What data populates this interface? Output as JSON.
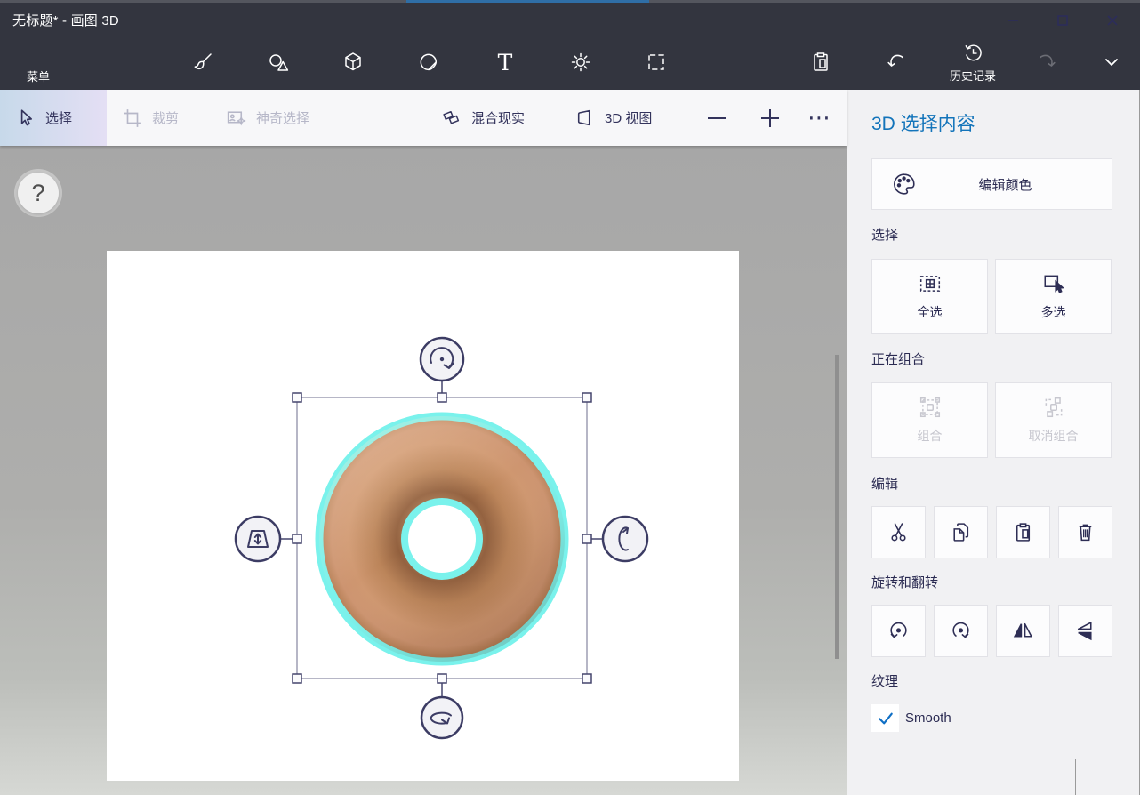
{
  "colors": {
    "accent_blue": "#1374ba",
    "header_bg": "#33353f",
    "selection_glow_cyan": "#7af2ec",
    "donut_brown": "#cf9770",
    "ribbon_selected_gradient": [
      "#c7d9ea",
      "#e4dff4"
    ]
  },
  "titlebar": {
    "title": "无标题* - 画图 3D"
  },
  "toolbar": {
    "menu_label": "菜单",
    "history_label": "历史记录",
    "icons": [
      "menu-folder",
      "brush",
      "shapes-2d",
      "shapes-3d",
      "stickers",
      "text",
      "effects",
      "canvas",
      "paste",
      "undo",
      "history-clock",
      "redo-disabled",
      "chevron-down"
    ]
  },
  "ribbon": {
    "select": "选择",
    "crop": "裁剪",
    "magic_select": "神奇选择",
    "mixed_reality": "混合现实",
    "view_3d": "3D 视图",
    "more": "⋯"
  },
  "workspace": {
    "help": "?",
    "object": "3d-torus-donut-selected",
    "rotation_handles": [
      "rotate-z-top",
      "depth-left",
      "rotate-y-right",
      "rotate-x-bottom"
    ]
  },
  "panel": {
    "title": "3D 选择内容",
    "edit_color": "编辑颜色",
    "select_section": {
      "label": "选择",
      "select_all": "全选",
      "multi_select": "多选"
    },
    "group_section": {
      "label": "正在组合",
      "group": "组合",
      "ungroup": "取消组合"
    },
    "edit_section": {
      "label": "编辑",
      "icons": [
        "cut",
        "copy",
        "paste",
        "delete"
      ]
    },
    "rotate_section": {
      "label": "旋转和翻转",
      "icons": [
        "rotate-left",
        "rotate-right",
        "flip-horizontal",
        "flip-vertical"
      ]
    },
    "texture_section": {
      "label": "纹理",
      "smooth_label": "Smooth",
      "smooth_checked": true
    }
  }
}
